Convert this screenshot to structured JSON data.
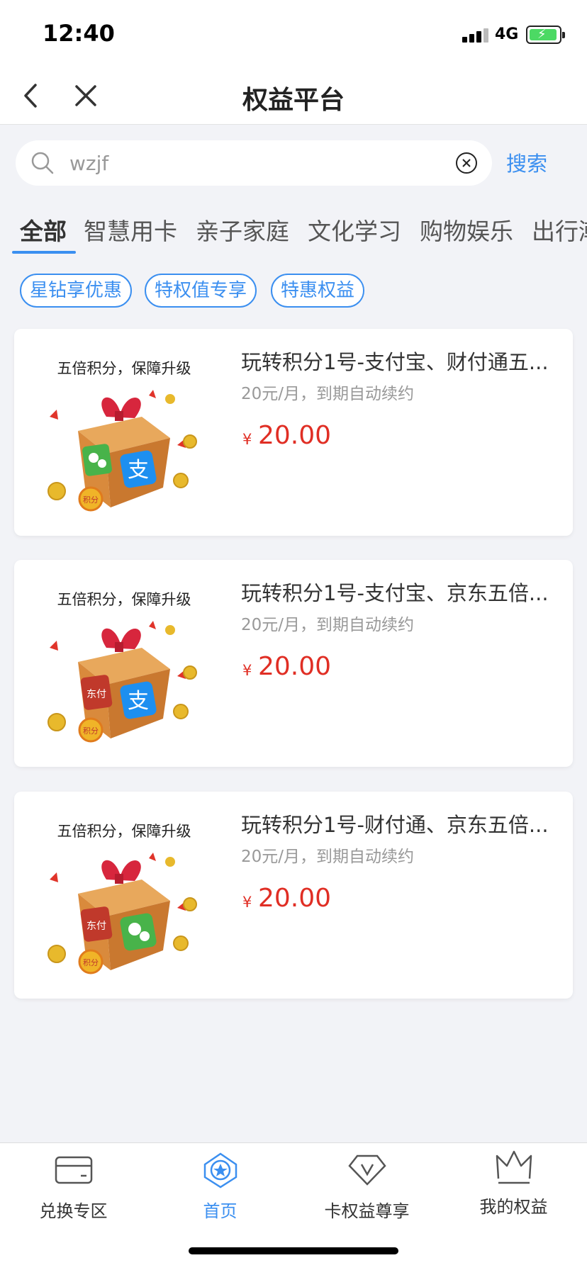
{
  "status_bar": {
    "time": "12:40",
    "network": "4G"
  },
  "nav": {
    "title": "权益平台"
  },
  "search": {
    "value": "wzjf",
    "button_label": "搜索"
  },
  "categories": [
    "全部",
    "智慧用卡",
    "亲子家庭",
    "文化学习",
    "购物娱乐",
    "出行潮"
  ],
  "active_category": "全部",
  "chips": [
    "星钻享优惠",
    "特权值专享",
    "特惠权益"
  ],
  "products": [
    {
      "thumb_tag": "五倍积分，保障升级",
      "title": "玩转积分1号-支付宝、财付通五...",
      "subtitle": "20元/月，到期自动续约",
      "currency": "¥",
      "price": "20.00",
      "thumb_icons": [
        "wechat-pay-icon",
        "alipay-icon"
      ]
    },
    {
      "thumb_tag": "五倍积分，保障升级",
      "title": "玩转积分1号-支付宝、京东五倍...",
      "subtitle": "20元/月，到期自动续约",
      "currency": "¥",
      "price": "20.00",
      "thumb_icons": [
        "jd-pay-icon",
        "alipay-icon"
      ]
    },
    {
      "thumb_tag": "五倍积分，保障升级",
      "title": "玩转积分1号-财付通、京东五倍...",
      "subtitle": "20元/月，到期自动续约",
      "currency": "¥",
      "price": "20.00",
      "thumb_icons": [
        "jd-pay-icon",
        "wechat-pay-icon"
      ]
    }
  ],
  "thumb_badges": {
    "jd": "东付",
    "coin": "积分"
  },
  "tab_bar": [
    {
      "label": "兑换专区",
      "icon": "card-icon"
    },
    {
      "label": "首页",
      "icon": "home-badge-icon",
      "active": true
    },
    {
      "label": "卡权益尊享",
      "icon": "diamond-v-icon"
    },
    {
      "label": "我的权益",
      "icon": "crown-icon"
    }
  ],
  "colors": {
    "accent": "#3b8ff0",
    "price": "#e02e24",
    "background": "#f2f3f7"
  }
}
